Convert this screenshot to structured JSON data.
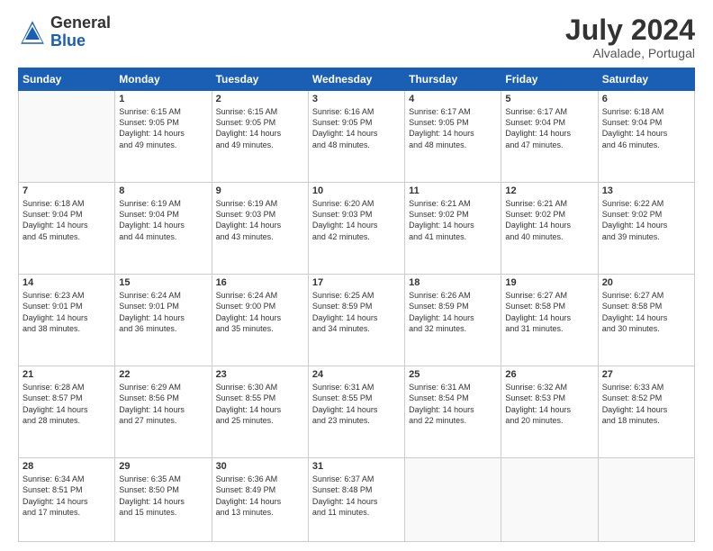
{
  "header": {
    "logo_general": "General",
    "logo_blue": "Blue",
    "month_year": "July 2024",
    "location": "Alvalade, Portugal"
  },
  "columns": [
    "Sunday",
    "Monday",
    "Tuesday",
    "Wednesday",
    "Thursday",
    "Friday",
    "Saturday"
  ],
  "weeks": [
    [
      {
        "day": "",
        "info": ""
      },
      {
        "day": "1",
        "info": "Sunrise: 6:15 AM\nSunset: 9:05 PM\nDaylight: 14 hours\nand 49 minutes."
      },
      {
        "day": "2",
        "info": "Sunrise: 6:15 AM\nSunset: 9:05 PM\nDaylight: 14 hours\nand 49 minutes."
      },
      {
        "day": "3",
        "info": "Sunrise: 6:16 AM\nSunset: 9:05 PM\nDaylight: 14 hours\nand 48 minutes."
      },
      {
        "day": "4",
        "info": "Sunrise: 6:17 AM\nSunset: 9:05 PM\nDaylight: 14 hours\nand 48 minutes."
      },
      {
        "day": "5",
        "info": "Sunrise: 6:17 AM\nSunset: 9:04 PM\nDaylight: 14 hours\nand 47 minutes."
      },
      {
        "day": "6",
        "info": "Sunrise: 6:18 AM\nSunset: 9:04 PM\nDaylight: 14 hours\nand 46 minutes."
      }
    ],
    [
      {
        "day": "7",
        "info": "Sunrise: 6:18 AM\nSunset: 9:04 PM\nDaylight: 14 hours\nand 45 minutes."
      },
      {
        "day": "8",
        "info": "Sunrise: 6:19 AM\nSunset: 9:04 PM\nDaylight: 14 hours\nand 44 minutes."
      },
      {
        "day": "9",
        "info": "Sunrise: 6:19 AM\nSunset: 9:03 PM\nDaylight: 14 hours\nand 43 minutes."
      },
      {
        "day": "10",
        "info": "Sunrise: 6:20 AM\nSunset: 9:03 PM\nDaylight: 14 hours\nand 42 minutes."
      },
      {
        "day": "11",
        "info": "Sunrise: 6:21 AM\nSunset: 9:02 PM\nDaylight: 14 hours\nand 41 minutes."
      },
      {
        "day": "12",
        "info": "Sunrise: 6:21 AM\nSunset: 9:02 PM\nDaylight: 14 hours\nand 40 minutes."
      },
      {
        "day": "13",
        "info": "Sunrise: 6:22 AM\nSunset: 9:02 PM\nDaylight: 14 hours\nand 39 minutes."
      }
    ],
    [
      {
        "day": "14",
        "info": "Sunrise: 6:23 AM\nSunset: 9:01 PM\nDaylight: 14 hours\nand 38 minutes."
      },
      {
        "day": "15",
        "info": "Sunrise: 6:24 AM\nSunset: 9:01 PM\nDaylight: 14 hours\nand 36 minutes."
      },
      {
        "day": "16",
        "info": "Sunrise: 6:24 AM\nSunset: 9:00 PM\nDaylight: 14 hours\nand 35 minutes."
      },
      {
        "day": "17",
        "info": "Sunrise: 6:25 AM\nSunset: 8:59 PM\nDaylight: 14 hours\nand 34 minutes."
      },
      {
        "day": "18",
        "info": "Sunrise: 6:26 AM\nSunset: 8:59 PM\nDaylight: 14 hours\nand 32 minutes."
      },
      {
        "day": "19",
        "info": "Sunrise: 6:27 AM\nSunset: 8:58 PM\nDaylight: 14 hours\nand 31 minutes."
      },
      {
        "day": "20",
        "info": "Sunrise: 6:27 AM\nSunset: 8:58 PM\nDaylight: 14 hours\nand 30 minutes."
      }
    ],
    [
      {
        "day": "21",
        "info": "Sunrise: 6:28 AM\nSunset: 8:57 PM\nDaylight: 14 hours\nand 28 minutes."
      },
      {
        "day": "22",
        "info": "Sunrise: 6:29 AM\nSunset: 8:56 PM\nDaylight: 14 hours\nand 27 minutes."
      },
      {
        "day": "23",
        "info": "Sunrise: 6:30 AM\nSunset: 8:55 PM\nDaylight: 14 hours\nand 25 minutes."
      },
      {
        "day": "24",
        "info": "Sunrise: 6:31 AM\nSunset: 8:55 PM\nDaylight: 14 hours\nand 23 minutes."
      },
      {
        "day": "25",
        "info": "Sunrise: 6:31 AM\nSunset: 8:54 PM\nDaylight: 14 hours\nand 22 minutes."
      },
      {
        "day": "26",
        "info": "Sunrise: 6:32 AM\nSunset: 8:53 PM\nDaylight: 14 hours\nand 20 minutes."
      },
      {
        "day": "27",
        "info": "Sunrise: 6:33 AM\nSunset: 8:52 PM\nDaylight: 14 hours\nand 18 minutes."
      }
    ],
    [
      {
        "day": "28",
        "info": "Sunrise: 6:34 AM\nSunset: 8:51 PM\nDaylight: 14 hours\nand 17 minutes."
      },
      {
        "day": "29",
        "info": "Sunrise: 6:35 AM\nSunset: 8:50 PM\nDaylight: 14 hours\nand 15 minutes."
      },
      {
        "day": "30",
        "info": "Sunrise: 6:36 AM\nSunset: 8:49 PM\nDaylight: 14 hours\nand 13 minutes."
      },
      {
        "day": "31",
        "info": "Sunrise: 6:37 AM\nSunset: 8:48 PM\nDaylight: 14 hours\nand 11 minutes."
      },
      {
        "day": "",
        "info": ""
      },
      {
        "day": "",
        "info": ""
      },
      {
        "day": "",
        "info": ""
      }
    ]
  ]
}
